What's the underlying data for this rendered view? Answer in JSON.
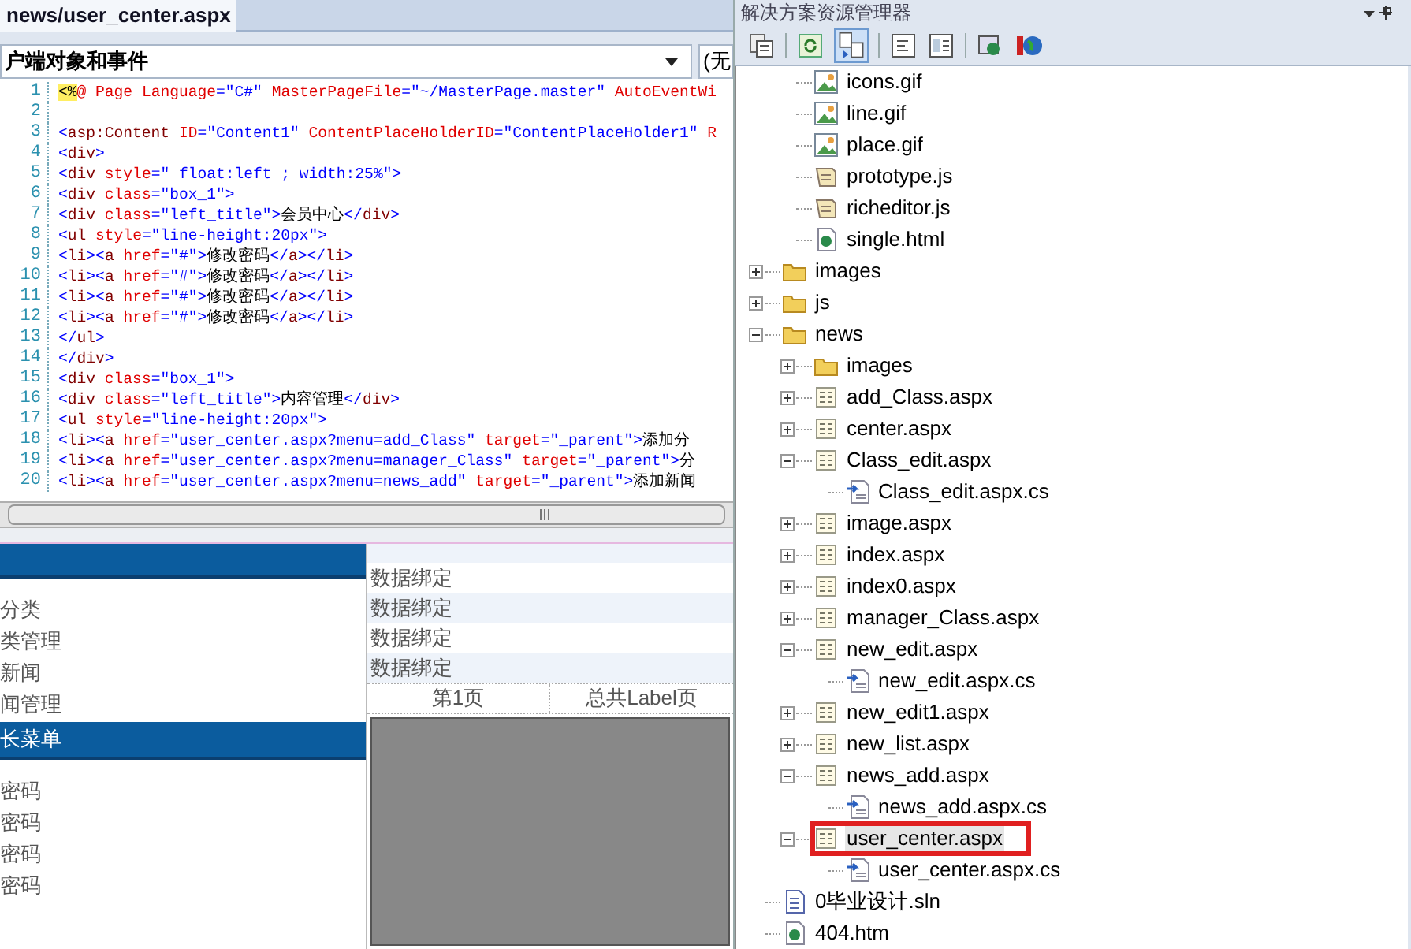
{
  "editor": {
    "tab": {
      "label": "news/user_center.aspx",
      "selected": true
    },
    "object_dropdown": {
      "value": "户端对象和事件"
    },
    "event_dropdown": {
      "value": "(无"
    },
    "code_lines": [
      {
        "number": "1",
        "text": "<%@ Page Language=\"C#\" MasterPageFile=\"~/MasterPage.master\" AutoEventWi"
      },
      {
        "number": "2"
      },
      {
        "number": "3",
        "text": "<asp:Content ID=\"Content1\" ContentPlaceHolderID=\"ContentPlaceHolder1\" R"
      },
      {
        "number": "4",
        "text": "<div>"
      },
      {
        "number": "5",
        "text": "<div style=\" float:left ; width:25%\">"
      },
      {
        "number": "6",
        "text": "<div class=\"box_1\">"
      },
      {
        "number": "7",
        "text": "<div class=\"left_title\">会员中心</div>"
      },
      {
        "number": "8",
        "text": "<ul style=\"line-height:20px\">"
      },
      {
        "number": "9",
        "text": "<li><a href=\"#\">修改密码</a></li>"
      },
      {
        "number": "10",
        "text": "<li><a href=\"#\">修改密码</a></li>"
      },
      {
        "number": "11",
        "text": "<li><a href=\"#\">修改密码</a></li>"
      },
      {
        "number": "12",
        "text": "<li><a href=\"#\">修改密码</a></li>"
      },
      {
        "number": "13",
        "text": "</ul>"
      },
      {
        "number": "14",
        "text": "</div>"
      },
      {
        "number": "15",
        "text": "<div class=\"box_1\">"
      },
      {
        "number": "16",
        "text": "<div class=\"left_title\">内容管理</div>"
      },
      {
        "number": "17",
        "text": "<ul style=\"line-height:20px\">"
      },
      {
        "number": "18",
        "text": "<li><a href=\"user_center.aspx?menu=add_Class\" target=\"_parent\">添加分"
      },
      {
        "number": "19",
        "text": "<li><a href=\"user_center.aspx?menu=manager_Class\" target=\"_parent\">分"
      },
      {
        "number": "20",
        "text": "<li><a href=\"user_center.aspx?menu=news_add\" target=\"_parent\">添加新闻"
      }
    ]
  },
  "design_view": {
    "menu_links": [
      "分类",
      "类管理",
      "新闻",
      "闻管理"
    ],
    "menu_header": "长菜单",
    "menu_links_2": [
      "密码",
      "密码",
      "密码",
      "密码"
    ],
    "data_rows": [
      "数据绑定",
      "数据绑定",
      "数据绑定",
      "数据绑定"
    ],
    "pager": {
      "current": "第1页",
      "total": "总共Label页"
    }
  },
  "solution_explorer": {
    "title": "解决方案资源管理器",
    "scrolled_children": [
      {
        "label": "icons.gif",
        "kind": "image",
        "selected": false
      },
      {
        "label": "line.gif",
        "kind": "image",
        "selected": false
      },
      {
        "label": "place.gif",
        "kind": "image",
        "selected": false
      },
      {
        "label": "prototype.js",
        "kind": "script",
        "selected": false
      },
      {
        "label": "richeditor.js",
        "kind": "script",
        "selected": false
      },
      {
        "label": "single.html",
        "kind": "html",
        "selected": false
      }
    ],
    "items": [
      {
        "label": "images",
        "kind": "folder",
        "expanded": false,
        "selected": false
      },
      {
        "label": "js",
        "kind": "folder",
        "expanded": false,
        "selected": false
      },
      {
        "label": "news",
        "kind": "folder",
        "expanded": true,
        "selected": false,
        "children": [
          {
            "label": "images",
            "kind": "folder",
            "expanded": false,
            "selected": false
          },
          {
            "label": "add_Class.aspx",
            "kind": "page",
            "expanded": false,
            "selected": false
          },
          {
            "label": "center.aspx",
            "kind": "page",
            "expanded": false,
            "selected": false
          },
          {
            "label": "Class_edit.aspx",
            "kind": "page",
            "expanded": true,
            "selected": false,
            "children": [
              {
                "label": "Class_edit.aspx.cs",
                "kind": "code",
                "selected": false
              }
            ]
          },
          {
            "label": "image.aspx",
            "kind": "page",
            "expanded": false,
            "selected": false
          },
          {
            "label": "index.aspx",
            "kind": "page",
            "expanded": false,
            "selected": false
          },
          {
            "label": "index0.aspx",
            "kind": "page",
            "expanded": false,
            "selected": false
          },
          {
            "label": "manager_Class.aspx",
            "kind": "page",
            "expanded": false,
            "selected": false
          },
          {
            "label": "new_edit.aspx",
            "kind": "page",
            "expanded": true,
            "selected": false,
            "children": [
              {
                "label": "new_edit.aspx.cs",
                "kind": "code",
                "selected": false
              }
            ]
          },
          {
            "label": "new_edit1.aspx",
            "kind": "page",
            "expanded": false,
            "selected": false
          },
          {
            "label": "new_list.aspx",
            "kind": "page",
            "expanded": false,
            "selected": false
          },
          {
            "label": "news_add.aspx",
            "kind": "page",
            "expanded": true,
            "selected": false,
            "children": [
              {
                "label": "news_add.aspx.cs",
                "kind": "code",
                "selected": false
              }
            ]
          },
          {
            "label": "user_center.aspx",
            "kind": "page",
            "expanded": true,
            "selected": true,
            "annotated": true,
            "children": [
              {
                "label": "user_center.aspx.cs",
                "kind": "code",
                "selected": false
              }
            ]
          }
        ]
      },
      {
        "label": "0毕业设计.sln",
        "kind": "solution",
        "selected": false
      },
      {
        "label": "404.htm",
        "kind": "html",
        "selected": false
      }
    ]
  }
}
